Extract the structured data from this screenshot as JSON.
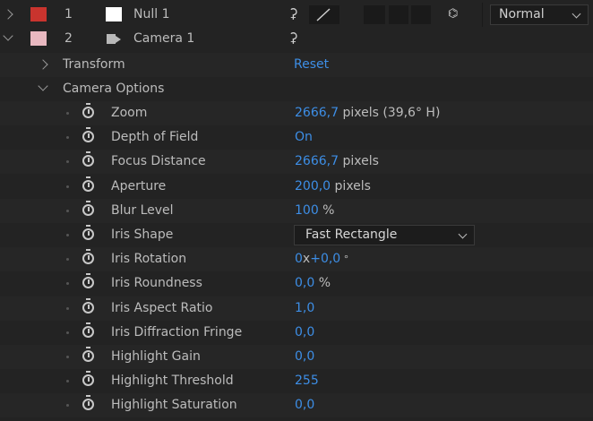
{
  "layers": [
    {
      "number": "1",
      "name": "Null 1",
      "label_color": "#c9342e",
      "type": "null",
      "switch_icon": "shy-icon",
      "extra_icon": "cube-icon",
      "blend_mode": "Normal"
    },
    {
      "number": "2",
      "name": "Camera 1",
      "label_color": "#e8b8c0",
      "type": "camera",
      "switch_icon": "shy-icon"
    }
  ],
  "transform": {
    "label": "Transform",
    "reset": "Reset"
  },
  "camera_options": {
    "label": "Camera Options",
    "props": [
      {
        "name": "Zoom",
        "value": "2666,7",
        "unit": " pixels (39,6° H)"
      },
      {
        "name": "Depth of Field",
        "value": "On",
        "unit": ""
      },
      {
        "name": "Focus Distance",
        "value": "2666,7",
        "unit": " pixels"
      },
      {
        "name": "Aperture",
        "value": "200,0",
        "unit": " pixels"
      },
      {
        "name": "Blur Level",
        "value": "100",
        "unit": " %"
      },
      {
        "name": "Iris Shape",
        "value": "Fast Rectangle",
        "unit": "",
        "dropdown": true
      },
      {
        "name": "Iris Rotation",
        "value": "0",
        "unit_mid": "x",
        "value2": "+0,0",
        "unit": " °"
      },
      {
        "name": "Iris Roundness",
        "value": "0,0",
        "unit": " %"
      },
      {
        "name": "Iris Aspect Ratio",
        "value": "1,0",
        "unit": ""
      },
      {
        "name": "Iris Diffraction Fringe",
        "value": "0,0",
        "unit": ""
      },
      {
        "name": "Highlight Gain",
        "value": "0,0",
        "unit": ""
      },
      {
        "name": "Highlight Threshold",
        "value": "255",
        "unit": ""
      },
      {
        "name": "Highlight Saturation",
        "value": "0,0",
        "unit": ""
      }
    ]
  }
}
